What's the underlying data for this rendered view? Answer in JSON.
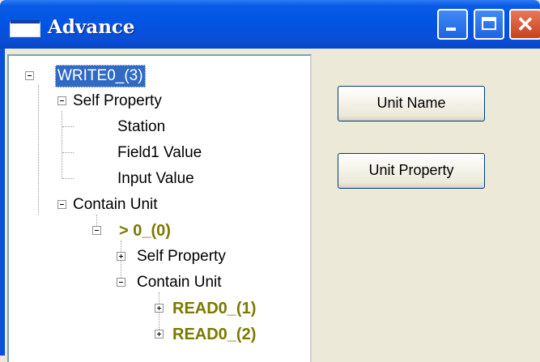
{
  "window": {
    "title": "Advance"
  },
  "tree": {
    "root": "WRITE0_(3)",
    "self_property": "Self Property",
    "station": "Station",
    "field1_value": "Field1 Value",
    "input_value": "Input Value",
    "contain_unit": "Contain Unit",
    "child_unit": "> 0_(0)",
    "child_self_property": "Self Property",
    "child_contain_unit": "Contain Unit",
    "read1": "READ0_(1)",
    "read2": "READ0_(2)"
  },
  "buttons": {
    "unit_name": "Unit Name",
    "unit_property": "Unit Property"
  },
  "colors": {
    "titlebar": "#0055e3",
    "selection": "#316ac5",
    "unit_text": "#7a7a00"
  }
}
